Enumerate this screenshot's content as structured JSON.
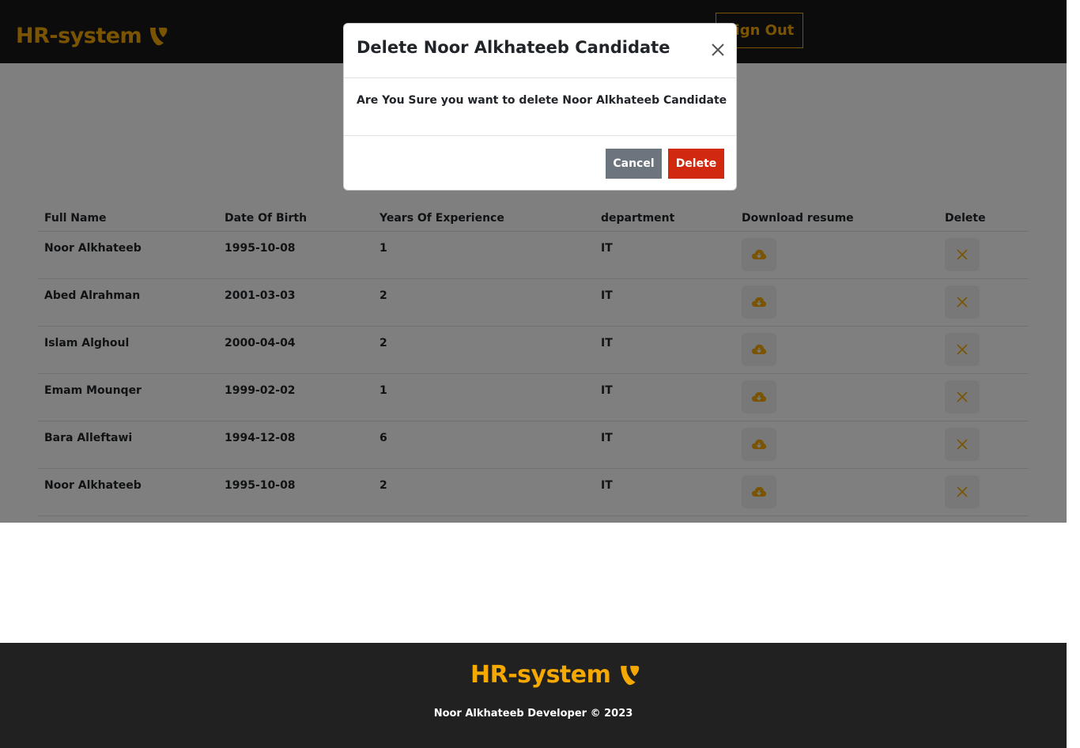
{
  "header": {
    "brand": "HR-system",
    "signout_label": "Sign Out"
  },
  "table": {
    "columns": [
      "Full Name",
      "Date Of Birth",
      "Years Of Experience",
      "department",
      "Download resume",
      "Delete"
    ],
    "rows": [
      {
        "name": "Noor Alkhateeb",
        "dob": "1995-10-08",
        "exp": "1",
        "dept": "IT"
      },
      {
        "name": "Abed Alrahman",
        "dob": "2001-03-03",
        "exp": "2",
        "dept": "IT"
      },
      {
        "name": "Islam Alghoul",
        "dob": "2000-04-04",
        "exp": "2",
        "dept": "IT"
      },
      {
        "name": "Emam Mounqer",
        "dob": "1999-02-02",
        "exp": "1",
        "dept": "IT"
      },
      {
        "name": "Bara Alleftawi",
        "dob": "1994-12-08",
        "exp": "6",
        "dept": "IT"
      },
      {
        "name": "Noor Alkhateeb",
        "dob": "1995-10-08",
        "exp": "2",
        "dept": "IT"
      }
    ]
  },
  "modal": {
    "title": "Delete Noor Alkhateeb Candidate",
    "message": "Are You Sure you want to delete Noor Alkhateeb Candidate",
    "cancel_label": "Cancel",
    "delete_label": "Delete"
  },
  "footer": {
    "brand": "HR-system",
    "copyright": "Noor Alkhateeb Developer © 2023"
  },
  "colors": {
    "accent": "#f4a800",
    "danger": "#d0290f",
    "secondary": "#6c757d"
  }
}
